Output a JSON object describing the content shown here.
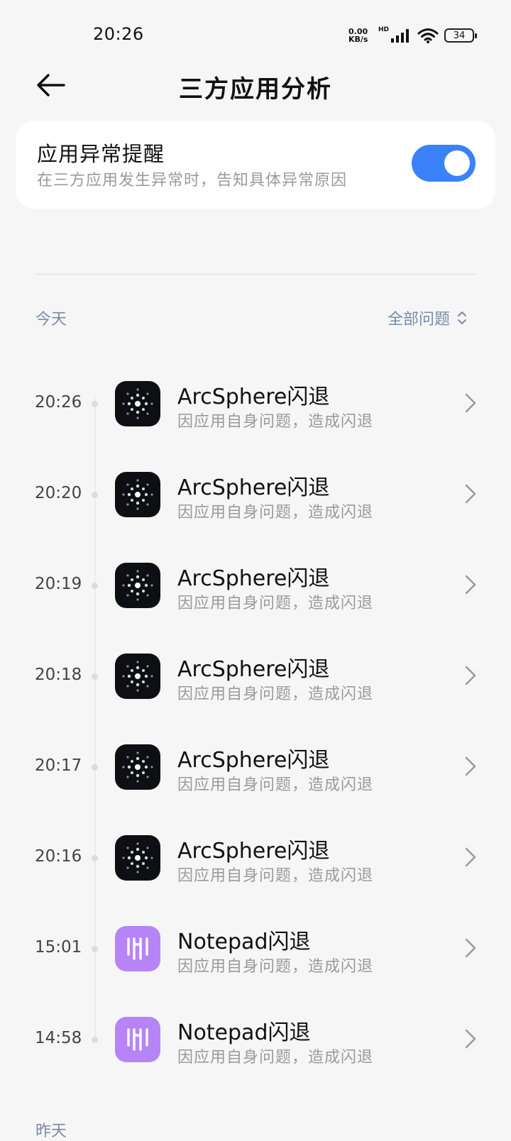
{
  "status_bar": {
    "time": "20:26",
    "net_speed_value": "0.00",
    "net_speed_unit": "KB/s",
    "hd_label": "HD",
    "battery": "34"
  },
  "header": {
    "title": "三方应用分析"
  },
  "alert_card": {
    "title": "应用异常提醒",
    "subtitle": "在三方应用发生异常时，告知具体异常原因",
    "enabled": true,
    "accent_color": "#3a82f7"
  },
  "sections": {
    "today": "今天",
    "yesterday": "昨天"
  },
  "filter": {
    "label": "全部问题"
  },
  "entries": [
    {
      "time": "20:26",
      "title": "ArcSphere闪退",
      "subtitle": "因应用自身问题，造成闪退",
      "icon": "arcsphere-icon"
    },
    {
      "time": "20:20",
      "title": "ArcSphere闪退",
      "subtitle": "因应用自身问题，造成闪退",
      "icon": "arcsphere-icon"
    },
    {
      "time": "20:19",
      "title": "ArcSphere闪退",
      "subtitle": "因应用自身问题，造成闪退",
      "icon": "arcsphere-icon"
    },
    {
      "time": "20:18",
      "title": "ArcSphere闪退",
      "subtitle": "因应用自身问题，造成闪退",
      "icon": "arcsphere-icon"
    },
    {
      "time": "20:17",
      "title": "ArcSphere闪退",
      "subtitle": "因应用自身问题，造成闪退",
      "icon": "arcsphere-icon"
    },
    {
      "time": "20:16",
      "title": "ArcSphere闪退",
      "subtitle": "因应用自身问题，造成闪退",
      "icon": "arcsphere-icon"
    },
    {
      "time": "15:01",
      "title": "Notepad闪退",
      "subtitle": "因应用自身问题，造成闪退",
      "icon": "notepad-icon"
    },
    {
      "time": "14:58",
      "title": "Notepad闪退",
      "subtitle": "因应用自身问题，造成闪退",
      "icon": "notepad-icon"
    }
  ]
}
